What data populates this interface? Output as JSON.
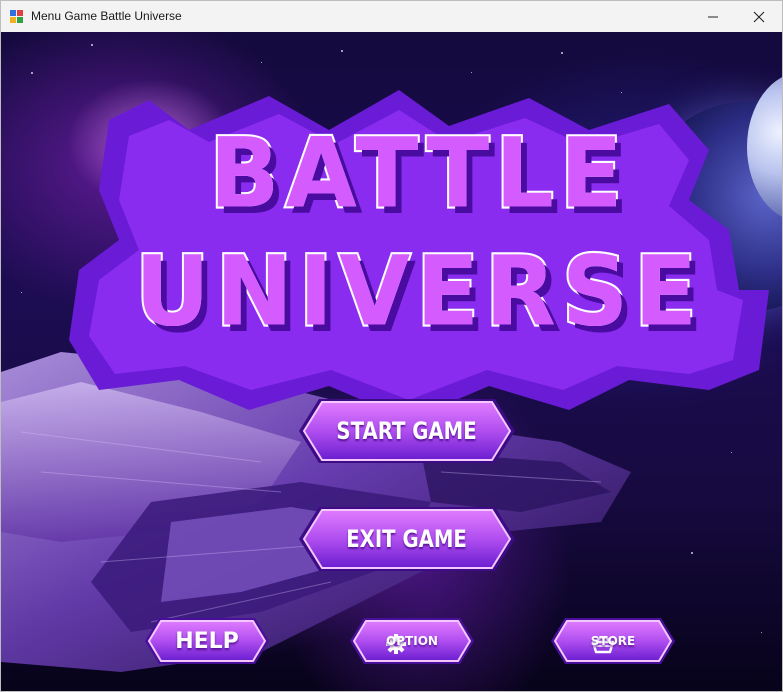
{
  "window": {
    "title": "Menu Game Battle Universe",
    "controls": {
      "minimize_icon": "minimize-icon",
      "maximize_icon": "maximize-icon",
      "close_icon": "close-icon"
    }
  },
  "logo": {
    "line1": "BATTLE",
    "line2": "UNIVERSE"
  },
  "menu": {
    "start_label": "START GAME",
    "exit_label": "EXIT GAME",
    "help_label": "HELP",
    "option_label": "OPTION",
    "option_icon": "gear-icon",
    "store_label": "STORE",
    "store_icon": "basket-icon"
  },
  "colors": {
    "accent": "#c25cf5",
    "button_fill_top": "#d070f8",
    "button_fill_bottom": "#7a22d8",
    "logo_fill": "#d45cff",
    "logo_outline": "#6a1bd6"
  }
}
